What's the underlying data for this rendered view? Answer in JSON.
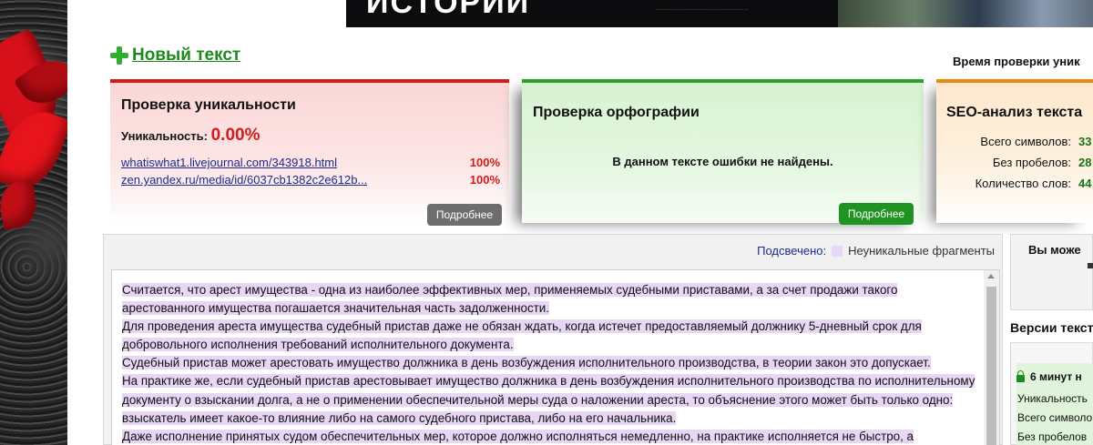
{
  "banner": {
    "title": "ИСТОРИЙ"
  },
  "new_text": {
    "label": "Новый текст"
  },
  "check_time": {
    "label": "Время проверки уник"
  },
  "uniqueness_card": {
    "title": "Проверка уникальности",
    "uniqueness_label": "Уникальность:",
    "uniqueness_value": "0.00%",
    "sources": [
      {
        "url": "whatiswhat1.livejournal.com/343918.html",
        "percent": "100%"
      },
      {
        "url": "zen.yandex.ru/media/id/6037cb1382c2e612b...",
        "percent": "100%"
      }
    ],
    "details_button": "Подробнее"
  },
  "spelling_card": {
    "title": "Проверка орфографии",
    "message": "В данном тексте ошибки не найдены.",
    "details_button": "Подробнее"
  },
  "seo_card": {
    "title": "SEO-анализ текста",
    "rows": [
      {
        "label": "Всего символов:",
        "value": "33"
      },
      {
        "label": "Без пробелов:",
        "value": "28"
      },
      {
        "label": "Количество слов:",
        "value": "44"
      }
    ]
  },
  "text_panel": {
    "legend_label": "Подсвечено:",
    "legend_text": "Неуникальные фрагменты",
    "paragraphs": [
      "Считается, что арест имущества - одна из наиболее эффективных мер, применяемых судебными приставами, а за счет продажи такого арестованного имущества погашается значительная часть задолженности.",
      "Для проведения ареста имущества судебный пристав даже не обязан ждать, когда истечет предоставляемый должнику 5-дневный срок для добровольного исполнения требований исполнительного документа.",
      "Судебный пристав может арестовать имущество должника в день возбуждения исполнительного производства, в теории закон это допускает.",
      "На практике же, если судебный пристав арестовывает имущество должника в день возбуждения исполнительного производства по исполнительному документу о взыскании долга, а не о применении обеспечительной меры суда о наложении ареста, то объяснение этого может быть только одно: взыскатель имеет какое-то влияние либо на самого судебного пристава, либо на его начальника.",
      "Даже исполнение принятых судом обеспечительных мер, которое должно исполняться немедленно, на практике исполняется не быстро, а"
    ]
  },
  "sidebar": {
    "box_title": "Вы може",
    "versions_title": "Версии текст",
    "version": {
      "time": "6 минут н",
      "rows": [
        "Уникальность",
        "Всего символо",
        "Без пробелов"
      ]
    }
  },
  "colors": {
    "uniq_accent": "#d41c1c",
    "spell_accent": "#2aa12a",
    "seo_accent": "#e88a12",
    "highlight": "#e8d6f5",
    "link": "#1b2b8f"
  }
}
